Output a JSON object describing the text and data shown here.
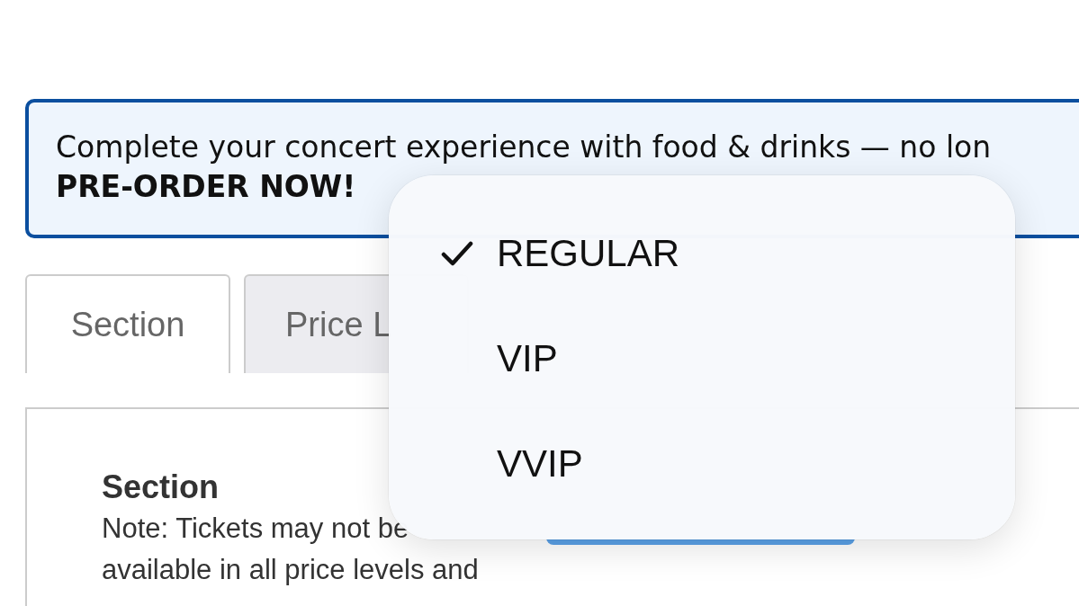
{
  "banner": {
    "message": "Complete your concert experience with food & drinks — no lon",
    "call_to_action": "PRE-ORDER NOW!"
  },
  "tabs": [
    {
      "label": "Section",
      "selected": true
    },
    {
      "label": "Price L",
      "selected": false
    }
  ],
  "panel": {
    "heading": "Section",
    "note": "Note: Tickets may not be available in all price levels and"
  },
  "menu": {
    "items": [
      {
        "label": "REGULAR",
        "selected": true
      },
      {
        "label": "VIP",
        "selected": false
      },
      {
        "label": "VVIP",
        "selected": false
      }
    ]
  }
}
